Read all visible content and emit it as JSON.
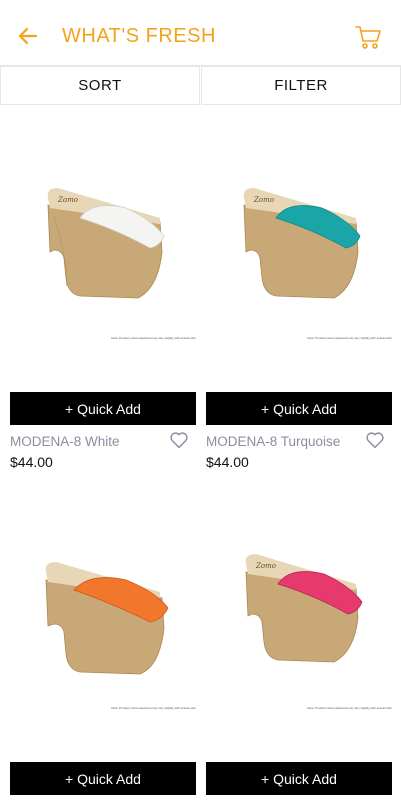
{
  "header": {
    "title": "WHAT'S FRESH",
    "accent_color": "#f5a21b",
    "back_icon": "arrow-left-icon",
    "cart_icon": "cart-icon"
  },
  "toolbar": {
    "sort_label": "SORT",
    "filter_label": "FILTER"
  },
  "products": [
    {
      "name": "MODENA-8 White",
      "price": "$44.00",
      "quick_add": "+ Quick Add",
      "shoe_color": "#f4f4f2",
      "disclaimer": "Note: Product colors depicted may vary slightly with actual color"
    },
    {
      "name": "MODENA-8 Turquoise",
      "price": "$44.00",
      "quick_add": "+ Quick Add",
      "shoe_color": "#1aa6a8",
      "disclaimer": "Note: Product colors depicted may vary slightly with actual color"
    },
    {
      "quick_add": "+ Quick Add",
      "shoe_color": "#f2772c",
      "disclaimer": "Note: Product colors depicted may vary slightly with actual color"
    },
    {
      "quick_add": "+ Quick Add",
      "shoe_color": "#e63a6e",
      "disclaimer": "Note: Product colors depicted may vary slightly with actual color"
    }
  ]
}
